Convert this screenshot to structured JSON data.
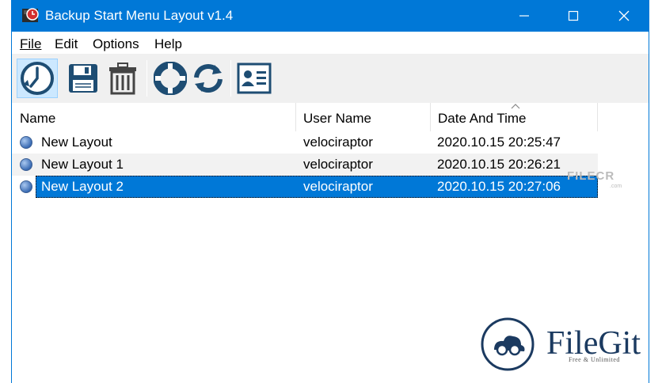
{
  "window": {
    "title": "Backup Start Menu Layout v1.4"
  },
  "menu": {
    "file": "File",
    "edit": "Edit",
    "options": "Options",
    "help": "Help"
  },
  "toolbar": {
    "buttons": [
      "backup-restore-icon",
      "save-icon",
      "trash-icon",
      "lifebuoy-icon",
      "refresh-icon",
      "contact-card-icon"
    ]
  },
  "list": {
    "columns": [
      "Name",
      "User Name",
      "Date And Time"
    ],
    "rows": [
      {
        "name": "New Layout",
        "user": "velociraptor",
        "datetime": "2020.10.15 20:25:47"
      },
      {
        "name": "New Layout 1",
        "user": "velociraptor",
        "datetime": "2020.10.15 20:26:21"
      },
      {
        "name": "New Layout 2",
        "user": "velociraptor",
        "datetime": "2020.10.15 20:27:06"
      }
    ],
    "selected_row": 2
  },
  "watermarks": {
    "small": "FILECR",
    "small_sub": ".com",
    "brand": "FileGit",
    "tagline": "Free & Unlimited"
  },
  "colors": {
    "titlebar": "#0078d7",
    "selection": "#0078d7",
    "toolbar_bg": "#f0f0f0"
  }
}
